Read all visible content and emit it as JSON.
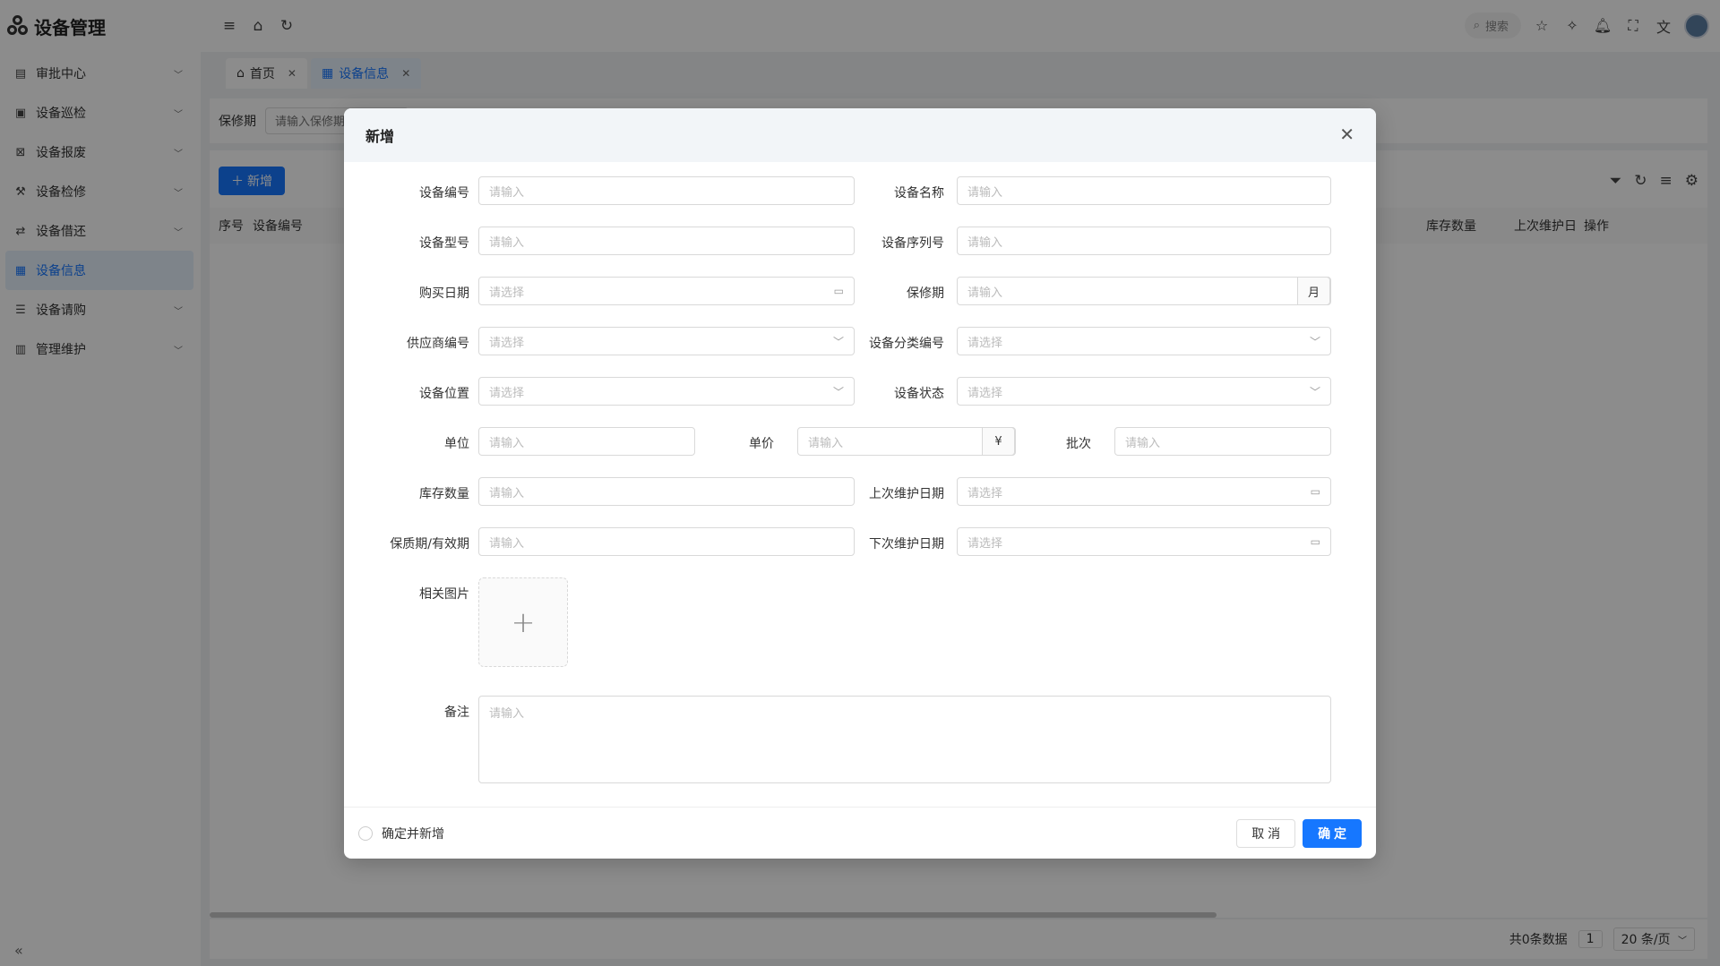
{
  "app": {
    "title": "设备管理"
  },
  "sidebar": {
    "items": [
      {
        "label": "审批中心",
        "icon": "approval-icon"
      },
      {
        "label": "设备巡检",
        "icon": "inspection-icon"
      },
      {
        "label": "设备报废",
        "icon": "scrap-icon"
      },
      {
        "label": "设备检修",
        "icon": "repair-icon"
      },
      {
        "label": "设备借还",
        "icon": "borrow-icon"
      },
      {
        "label": "设备信息",
        "icon": "info-icon",
        "active": true
      },
      {
        "label": "设备请购",
        "icon": "purchase-icon"
      },
      {
        "label": "管理维护",
        "icon": "maintain-icon"
      }
    ]
  },
  "header": {
    "search_label": "搜索"
  },
  "tabs": [
    {
      "label": "首页",
      "icon": "home-icon"
    },
    {
      "label": "设备信息",
      "icon": "doc-icon",
      "active": true
    }
  ],
  "filter": {
    "label": "保修期",
    "placeholder": "请输入保修期"
  },
  "table": {
    "add_label": "新增",
    "columns_left": [
      "序号",
      "设备编号"
    ],
    "columns_right": [
      "库存数量",
      "上次维护日",
      "操作"
    ],
    "total": "共0条数据",
    "page": "1",
    "page_size": "20 条/页"
  },
  "modal": {
    "title": "新增",
    "fields": {
      "device_no": {
        "label": "设备编号",
        "placeholder": "请输入"
      },
      "device_name": {
        "label": "设备名称",
        "placeholder": "请输入"
      },
      "device_model": {
        "label": "设备型号",
        "placeholder": "请输入"
      },
      "serial_no": {
        "label": "设备序列号",
        "placeholder": "请输入"
      },
      "purchase_date": {
        "label": "购买日期",
        "placeholder": "请选择"
      },
      "warranty": {
        "label": "保修期",
        "placeholder": "请输入",
        "suffix": "月"
      },
      "supplier_no": {
        "label": "供应商编号",
        "placeholder": "请选择"
      },
      "category_no": {
        "label": "设备分类编号",
        "placeholder": "请选择"
      },
      "location": {
        "label": "设备位置",
        "placeholder": "请选择"
      },
      "status": {
        "label": "设备状态",
        "placeholder": "请选择"
      },
      "unit": {
        "label": "单位",
        "placeholder": "请输入"
      },
      "price": {
        "label": "单价",
        "placeholder": "请输入",
        "suffix": "¥"
      },
      "batch": {
        "label": "批次",
        "placeholder": "请输入"
      },
      "stock": {
        "label": "库存数量",
        "placeholder": "请输入"
      },
      "last_maint": {
        "label": "上次维护日期",
        "placeholder": "请选择"
      },
      "shelf_life": {
        "label": "保质期/有效期",
        "placeholder": "请输入"
      },
      "next_maint": {
        "label": "下次维护日期",
        "placeholder": "请选择"
      },
      "images": {
        "label": "相关图片"
      },
      "remark": {
        "label": "备注",
        "placeholder": "请输入"
      }
    },
    "footer": {
      "confirm_add": "确定并新增",
      "cancel": "取 消",
      "ok": "确 定"
    }
  }
}
